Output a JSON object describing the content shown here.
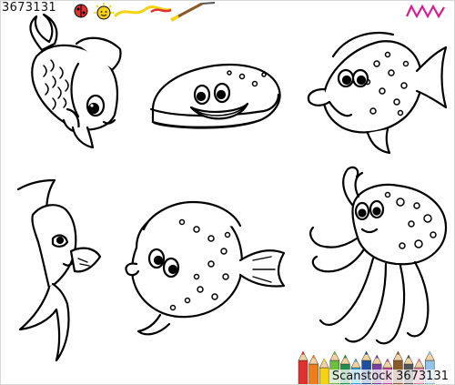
{
  "watermark": {
    "top_id": "3673131",
    "bottom_id": "Scanstock 3673131"
  },
  "colors": {
    "ink": "#000000",
    "paper": "#ffffff",
    "brand_magenta": "#d6218f",
    "pencils": [
      "#e0312f",
      "#f07d1b",
      "#f4d214",
      "#6bbf3b",
      "#1f8f4e",
      "#2fa6dd",
      "#1d4fa3",
      "#7a3fa0",
      "#c8449b",
      "#8b5a2b",
      "#555555",
      "#e87aa6",
      "#94c3e8"
    ]
  },
  "illustrations": [
    {
      "id": "fish-top-left",
      "icon": "fish-outline-icon"
    },
    {
      "id": "shellfish-top-center",
      "icon": "shellfish-outline-icon"
    },
    {
      "id": "fish-top-right",
      "icon": "tang-fish-outline-icon"
    },
    {
      "id": "fish-middle-left",
      "icon": "betta-fish-outline-icon"
    },
    {
      "id": "flounder-center",
      "icon": "flounder-outline-icon"
    },
    {
      "id": "octopus-right",
      "icon": "octopus-outline-icon"
    }
  ]
}
